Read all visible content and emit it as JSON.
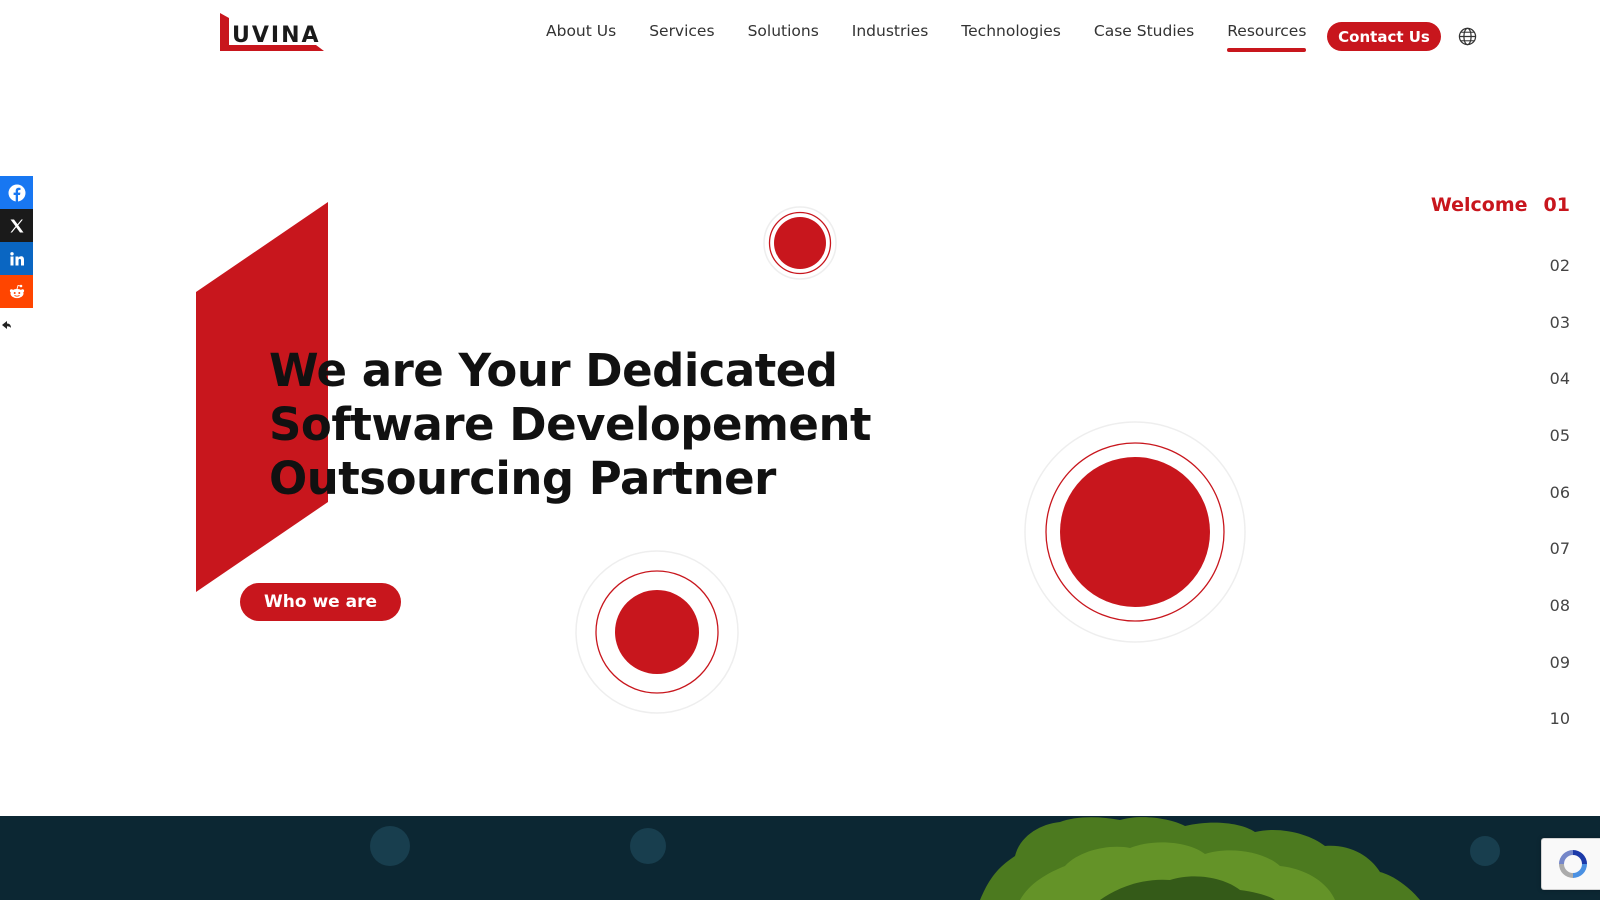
{
  "header": {
    "logo_text": "UVINA",
    "nav": [
      {
        "label": "About Us"
      },
      {
        "label": "Services"
      },
      {
        "label": "Solutions"
      },
      {
        "label": "Industries"
      },
      {
        "label": "Technologies"
      },
      {
        "label": "Case Studies"
      },
      {
        "label": "Resources",
        "active": true
      }
    ],
    "contact_label": "Contact Us",
    "globe_icon": "globe-icon"
  },
  "share": {
    "icons": [
      "facebook-icon",
      "x-icon",
      "linkedin-icon",
      "reddit-icon",
      "hide-share-icon"
    ]
  },
  "hero": {
    "title_lines": [
      "We are Your Dedicated",
      "Software Developement",
      "Outsourcing Partner"
    ],
    "cta_label": "Who we are"
  },
  "sections": {
    "active_label": "Welcome",
    "items": [
      "01",
      "02",
      "03",
      "04",
      "05",
      "06",
      "07",
      "08",
      "09",
      "10"
    ]
  },
  "colors": {
    "brand_red": "#c8161d",
    "band_dark": "#0c2733"
  }
}
